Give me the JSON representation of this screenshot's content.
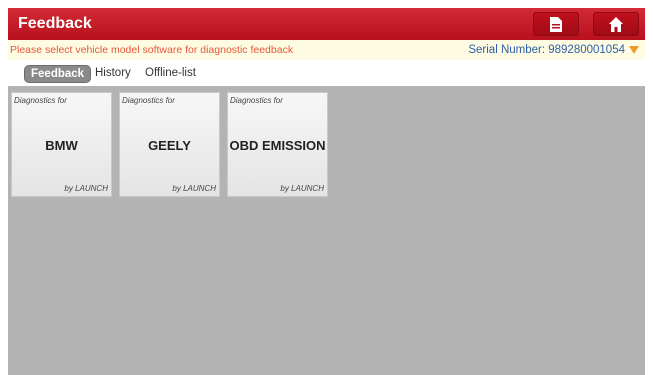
{
  "header": {
    "title": "Feedback",
    "buttons": [
      {
        "name": "report",
        "icon": "document-icon"
      },
      {
        "name": "home",
        "icon": "home-icon"
      }
    ]
  },
  "info": {
    "hint": "Please select vehicle model software for diagnostic feedback",
    "serial_label": "Serial Number:",
    "serial_value": "989280001054"
  },
  "tabs": [
    {
      "label": "Feedback",
      "active": true
    },
    {
      "label": "History",
      "active": false
    },
    {
      "label": "Offline-list",
      "active": false
    }
  ],
  "tiles": [
    {
      "prefix": "Diagnostics for",
      "name": "BMW",
      "vendor": "by LAUNCH"
    },
    {
      "prefix": "Diagnostics for",
      "name": "GEELY",
      "vendor": "by LAUNCH"
    },
    {
      "prefix": "Diagnostics for",
      "name": "OBD EMISSION",
      "vendor": "by LAUNCH"
    }
  ],
  "colors": {
    "header_red": "#c41a25",
    "hint_text": "#e8573f",
    "serial_text": "#2f5fa8",
    "content_bg": "#b3b3b3"
  }
}
